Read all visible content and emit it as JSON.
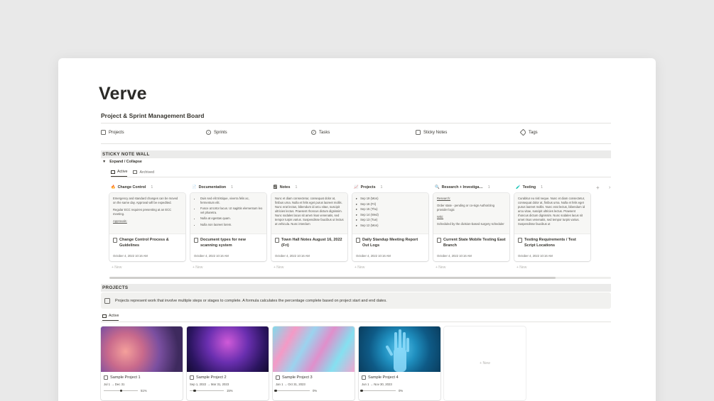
{
  "page": {
    "title": "Verve",
    "subtitle": "Project & Sprint Management Board"
  },
  "nav": [
    {
      "label": "Projects",
      "icon": "projects-icon"
    },
    {
      "label": "Sprints",
      "icon": "sprints-icon"
    },
    {
      "label": "Tasks",
      "icon": "tasks-icon"
    },
    {
      "label": "Sticky Notes",
      "icon": "sticky-notes-icon"
    },
    {
      "label": "Tags",
      "icon": "tags-icon"
    }
  ],
  "sticky": {
    "section_label": "STICKY NOTE WALL",
    "toggle_label": "Expand / Collapse",
    "tabs": [
      "Active",
      "Archived"
    ],
    "new_label": "+ New",
    "columns": [
      {
        "emoji": "🔥",
        "name": "Change Control",
        "count": "1",
        "preview_type": "text",
        "preview": [
          "Emergency and standard changes can be moved on the same day. Approval will be expedited.",
          "Regular ECC requires presenting at an ECC meeting.",
          "Approvals:"
        ],
        "card_title": "Change Control Process & Guidelines",
        "date": "October 4, 2022 10:16 AM"
      },
      {
        "emoji": "📄",
        "name": "Documentation",
        "count": "1",
        "preview_type": "bullets",
        "preview": [
          "Duis sed elit tristique, viverra felis ac, fermentum elit.",
          "Fusce at tortor lacus. Ut sagittis elementum leo vel pharetra.",
          "Nulla at egestas quam.",
          "Nulla non laoreet lorem."
        ],
        "card_title": "Document types for new scanning system",
        "date": "October 4, 2022 10:16 AM"
      },
      {
        "emoji": "🗒",
        "name": "Notes",
        "count": "1",
        "preview_type": "text",
        "preview": [
          "Nunc et diam consectetur, consequat dolor at, finibus urna. Nulla et felis eget purus laoreet mollis. Nunc erat lectus, bibendum id arcu vitae, suscipit ultricies lectus. Praesent rhoncus dictum dignissim. Nunc sodales lacus sit amet risus venenatis, sed tempor turpis varius. Suspendisse faucibus ut lectus at vehicula. Nunc interdum"
        ],
        "card_title": "Town Hall Notes August 16, 2022 (Fri)",
        "date": "October 4, 2022 10:16 AM"
      },
      {
        "emoji": "📈",
        "name": "Projects",
        "count": "1",
        "preview_type": "triangles",
        "preview": [
          "Sep 19 (Mon)",
          "Sep 16 (Fri)",
          "Sep 15 (Thu)",
          "Sep 14 (Wed)",
          "Sep 13 (Tue)",
          "Sep 12 (Mon)"
        ],
        "card_title": "Daily Standup Meeting Report Out Logs",
        "date": "October 4, 2022 10:16 AM"
      },
      {
        "emoji": "🔍",
        "name": "Research + Investiga…",
        "count": "1",
        "preview_type": "text",
        "preview": [
          "Research:",
          "Order state - pending or co-sign Authorizing provider logic",
          "Wiki:",
          "Scheduled by the division-based surgery scheduler"
        ],
        "card_title": "Current State Mobile Testing East Branch",
        "date": "October 4, 2022 10:16 AM"
      },
      {
        "emoji": "🧪",
        "name": "Testing",
        "count": "1",
        "preview_type": "text",
        "preview": [
          "Curabitur eu nisl neque. Nunc et diam consectetur, consequat dolor at, finibus urna. Nulla et felis eget purus laoreet mollis. Nunc erat lectus, bibendum id arcu vitae, suscipit ultricies lectus. Praesent rhoncus dictum dignissim. Nunc sodales lacus sit amet risus venenatis, sed tempor turpis varius. Suspendisse faucibus ut"
        ],
        "card_title": "Testing Requirements / Test Script Locations",
        "date": "October 4, 2022 10:16 AM"
      }
    ]
  },
  "projects": {
    "section_label": "PROJECTS",
    "callout": "Projects represent work that involve multiple steps or stages to complete. A formula calculates the percentage complete based on project start and end dates.",
    "tab": "Active",
    "new_label": "+ New",
    "cards": [
      {
        "name": "Sample Project 1",
        "dates": "Jul 1 → Dec 31",
        "progress": 0.51,
        "progress_label": "51%"
      },
      {
        "name": "Sample Project 2",
        "dates": "Sep 1, 2022 → Mar 31, 2023",
        "progress": 0.15,
        "progress_label": "15%"
      },
      {
        "name": "Sample Project 3",
        "dates": "Jan 1 → Oct 31, 2023",
        "progress": 0.0,
        "progress_label": "0%"
      },
      {
        "name": "Sample Project 4",
        "dates": "Jun 1 → Nov 30, 2023",
        "progress": 0.0,
        "progress_label": "0%"
      }
    ]
  }
}
